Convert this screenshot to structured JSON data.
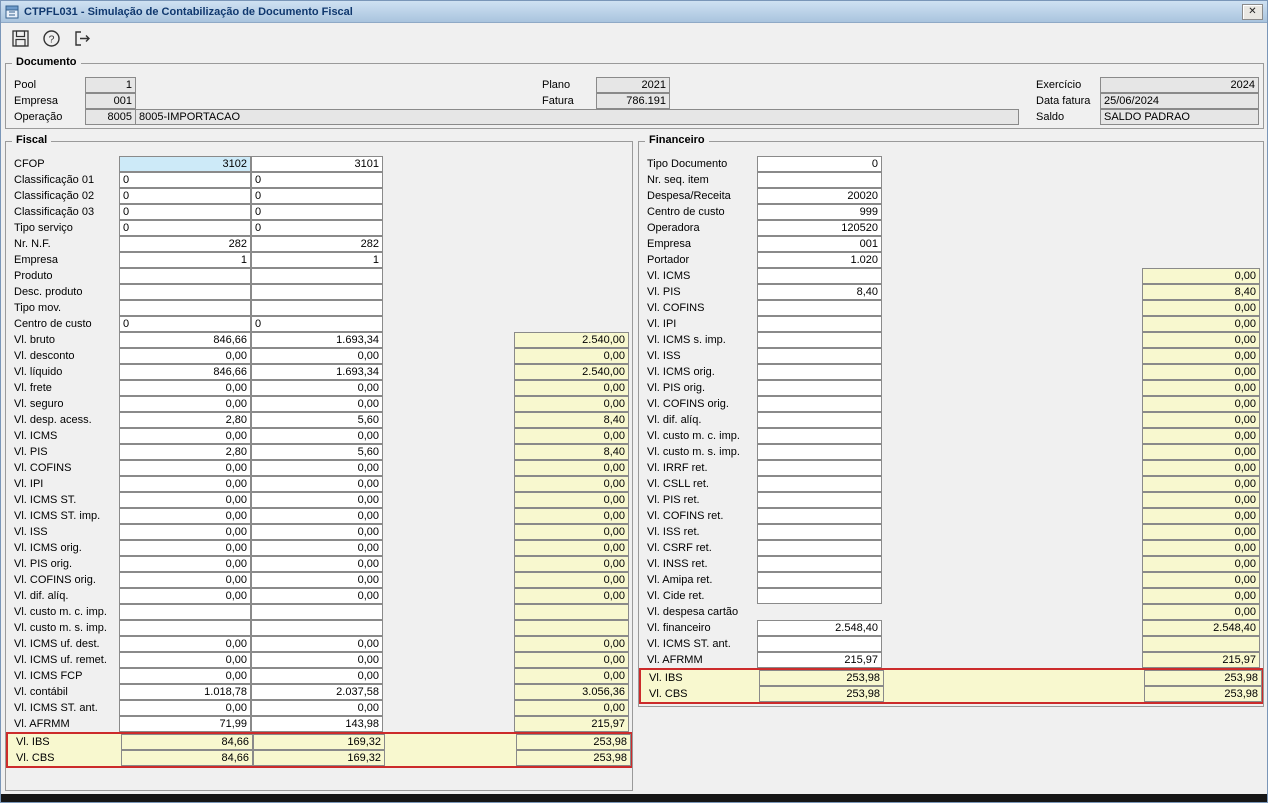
{
  "window": {
    "title": "CTPFL031 - Simulação de Contabilização de Documento Fiscal",
    "close_glyph": "✕"
  },
  "toolbar": {
    "icons": [
      "save-icon",
      "help-icon",
      "exit-icon"
    ]
  },
  "documento": {
    "legend": "Documento",
    "pool_label": "Pool",
    "pool": "1",
    "empresa_label": "Empresa",
    "empresa": "001",
    "operacao_label": "Operação",
    "operacao": "8005",
    "operacao_desc": "8005-IMPORTACAO",
    "plano_label": "Plano",
    "plano": "2021",
    "fatura_label": "Fatura",
    "fatura": "786.191",
    "exercicio_label": "Exercício",
    "exercicio": "2024",
    "data_fatura_label": "Data fatura",
    "data_fatura": "25/06/2024",
    "saldo_label": "Saldo",
    "saldo": "SALDO PADRAO"
  },
  "fiscal": {
    "legend": "Fiscal",
    "rows": [
      {
        "label": "CFOP",
        "c1": "3102",
        "c2": "3101",
        "a": "r",
        "cfop": true
      },
      {
        "label": "Classificação 01",
        "c1": "0",
        "c2": "0",
        "a": "l"
      },
      {
        "label": "Classificação 02",
        "c1": "0",
        "c2": "0",
        "a": "l"
      },
      {
        "label": "Classificação 03",
        "c1": "0",
        "c2": "0",
        "a": "l"
      },
      {
        "label": "Tipo serviço",
        "c1": "0",
        "c2": "0",
        "a": "l"
      },
      {
        "label": "Nr. N.F.",
        "c1": "282",
        "c2": "282",
        "a": "r"
      },
      {
        "label": "Empresa",
        "c1": "1",
        "c2": "1",
        "a": "r"
      },
      {
        "label": "Produto",
        "c1": "",
        "c2": "",
        "a": "l"
      },
      {
        "label": "Desc. produto",
        "c1": "",
        "c2": "",
        "a": "l"
      },
      {
        "label": "Tipo mov.",
        "c1": "",
        "c2": "",
        "a": "l"
      },
      {
        "label": "Centro de custo",
        "c1": "0",
        "c2": "0",
        "a": "l"
      },
      {
        "label": "Vl. bruto",
        "c1": "846,66",
        "c2": "1.693,34",
        "t": "2.540,00",
        "a": "r"
      },
      {
        "label": "Vl. desconto",
        "c1": "0,00",
        "c2": "0,00",
        "t": "0,00",
        "a": "r"
      },
      {
        "label": "Vl. líquido",
        "c1": "846,66",
        "c2": "1.693,34",
        "t": "2.540,00",
        "a": "r"
      },
      {
        "label": "Vl. frete",
        "c1": "0,00",
        "c2": "0,00",
        "t": "0,00",
        "a": "r"
      },
      {
        "label": "Vl. seguro",
        "c1": "0,00",
        "c2": "0,00",
        "t": "0,00",
        "a": "r"
      },
      {
        "label": "Vl. desp. acess.",
        "c1": "2,80",
        "c2": "5,60",
        "t": "8,40",
        "a": "r"
      },
      {
        "label": "Vl. ICMS",
        "c1": "0,00",
        "c2": "0,00",
        "t": "0,00",
        "a": "r"
      },
      {
        "label": "Vl. PIS",
        "c1": "2,80",
        "c2": "5,60",
        "t": "8,40",
        "a": "r"
      },
      {
        "label": "Vl. COFINS",
        "c1": "0,00",
        "c2": "0,00",
        "t": "0,00",
        "a": "r"
      },
      {
        "label": "Vl. IPI",
        "c1": "0,00",
        "c2": "0,00",
        "t": "0,00",
        "a": "r"
      },
      {
        "label": "Vl. ICMS ST.",
        "c1": "0,00",
        "c2": "0,00",
        "t": "0,00",
        "a": "r"
      },
      {
        "label": "Vl. ICMS ST. imp.",
        "c1": "0,00",
        "c2": "0,00",
        "t": "0,00",
        "a": "r"
      },
      {
        "label": "Vl. ISS",
        "c1": "0,00",
        "c2": "0,00",
        "t": "0,00",
        "a": "r"
      },
      {
        "label": "Vl. ICMS orig.",
        "c1": "0,00",
        "c2": "0,00",
        "t": "0,00",
        "a": "r"
      },
      {
        "label": "Vl. PIS orig.",
        "c1": "0,00",
        "c2": "0,00",
        "t": "0,00",
        "a": "r"
      },
      {
        "label": "Vl. COFINS orig.",
        "c1": "0,00",
        "c2": "0,00",
        "t": "0,00",
        "a": "r"
      },
      {
        "label": "Vl. dif. alíq.",
        "c1": "0,00",
        "c2": "0,00",
        "t": "0,00",
        "a": "r"
      },
      {
        "label": "Vl. custo m. c. imp.",
        "c1": "",
        "c2": "",
        "t": "",
        "a": "r"
      },
      {
        "label": "Vl. custo m. s. imp.",
        "c1": "",
        "c2": "",
        "t": "",
        "a": "r"
      },
      {
        "label": "Vl. ICMS uf. dest.",
        "c1": "0,00",
        "c2": "0,00",
        "t": "0,00",
        "a": "r"
      },
      {
        "label": "Vl. ICMS uf. remet.",
        "c1": "0,00",
        "c2": "0,00",
        "t": "0,00",
        "a": "r"
      },
      {
        "label": "Vl. ICMS FCP",
        "c1": "0,00",
        "c2": "0,00",
        "t": "0,00",
        "a": "r"
      },
      {
        "label": "Vl. contábil",
        "c1": "1.018,78",
        "c2": "2.037,58",
        "t": "3.056,36",
        "a": "r"
      },
      {
        "label": "Vl. ICMS ST. ant.",
        "c1": "0,00",
        "c2": "0,00",
        "t": "0,00",
        "a": "r"
      },
      {
        "label": "Vl. AFRMM",
        "c1": "71,99",
        "c2": "143,98",
        "t": "215,97",
        "a": "r"
      },
      {
        "label": "Vl. IBS",
        "c1": "84,66",
        "c2": "169,32",
        "t": "253,98",
        "a": "r",
        "hl": true
      },
      {
        "label": "Vl. CBS",
        "c1": "84,66",
        "c2": "169,32",
        "t": "253,98",
        "a": "r",
        "hl": true
      }
    ]
  },
  "financeiro": {
    "legend": "Financeiro",
    "rows": [
      {
        "label": "Tipo Documento",
        "c1": "0",
        "a": "r"
      },
      {
        "label": "Nr. seq. item",
        "c1": "",
        "a": "r"
      },
      {
        "label": "Despesa/Receita",
        "c1": "20020",
        "a": "r"
      },
      {
        "label": "Centro de custo",
        "c1": "999",
        "a": "r"
      },
      {
        "label": "Operadora",
        "c1": "120520",
        "a": "r"
      },
      {
        "label": "Empresa",
        "c1": "001",
        "a": "r"
      },
      {
        "label": "Portador",
        "c1": "1.020",
        "a": "r"
      },
      {
        "label": "Vl. ICMS",
        "c1": "",
        "t": "0,00",
        "a": "r"
      },
      {
        "label": "Vl. PIS",
        "c1": "8,40",
        "t": "8,40",
        "a": "r"
      },
      {
        "label": "Vl. COFINS",
        "c1": "",
        "t": "0,00",
        "a": "r"
      },
      {
        "label": "Vl. IPI",
        "c1": "",
        "t": "0,00",
        "a": "r"
      },
      {
        "label": "Vl. ICMS s. imp.",
        "c1": "",
        "t": "0,00",
        "a": "r"
      },
      {
        "label": "Vl. ISS",
        "c1": "",
        "t": "0,00",
        "a": "r"
      },
      {
        "label": "Vl. ICMS orig.",
        "c1": "",
        "t": "0,00",
        "a": "r"
      },
      {
        "label": "Vl. PIS orig.",
        "c1": "",
        "t": "0,00",
        "a": "r"
      },
      {
        "label": "Vl. COFINS orig.",
        "c1": "",
        "t": "0,00",
        "a": "r"
      },
      {
        "label": "Vl. dif. alíq.",
        "c1": "",
        "t": "0,00",
        "a": "r"
      },
      {
        "label": "Vl. custo m. c. imp.",
        "c1": "",
        "t": "0,00",
        "a": "r"
      },
      {
        "label": "Vl. custo m. s. imp.",
        "c1": "",
        "t": "0,00",
        "a": "r"
      },
      {
        "label": "Vl. IRRF ret.",
        "c1": "",
        "t": "0,00",
        "a": "r"
      },
      {
        "label": "Vl. CSLL ret.",
        "c1": "",
        "t": "0,00",
        "a": "r"
      },
      {
        "label": "Vl. PIS ret.",
        "c1": "",
        "t": "0,00",
        "a": "r"
      },
      {
        "label": "Vl. COFINS ret.",
        "c1": "",
        "t": "0,00",
        "a": "r"
      },
      {
        "label": "Vl. ISS ret.",
        "c1": "",
        "t": "0,00",
        "a": "r"
      },
      {
        "label": "Vl. CSRF ret.",
        "c1": "",
        "t": "0,00",
        "a": "r"
      },
      {
        "label": "Vl. INSS ret.",
        "c1": "",
        "t": "0,00",
        "a": "r"
      },
      {
        "label": "Vl. Amipa ret.",
        "c1": "",
        "t": "0,00",
        "a": "r"
      },
      {
        "label": "Vl. Cide ret.",
        "c1": "",
        "t": "0,00",
        "a": "r"
      },
      {
        "label": "Vl. despesa cartão",
        "c1": null,
        "t": "0,00",
        "a": "r"
      },
      {
        "label": "Vl. financeiro",
        "c1": "2.548,40",
        "t": "2.548,40",
        "a": "r"
      },
      {
        "label": "Vl. ICMS ST. ant.",
        "c1": "",
        "t": "",
        "a": "r"
      },
      {
        "label": "Vl. AFRMM",
        "c1": "215,97",
        "t": "215,97",
        "a": "r"
      },
      {
        "label": "Vl. IBS",
        "c1": "253,98",
        "t": "253,98",
        "a": "r",
        "hl": true
      },
      {
        "label": "Vl. CBS",
        "c1": "253,98",
        "t": "253,98",
        "a": "r",
        "hl": true
      }
    ]
  },
  "colors": {
    "total_bg": "#f8f8cf",
    "cfop_bg": "#cdeaf8",
    "alert_border": "#cc2b2b",
    "titlebar_from": "#cfe1f2",
    "titlebar_to": "#a9c4de",
    "title_text": "#10386e"
  }
}
